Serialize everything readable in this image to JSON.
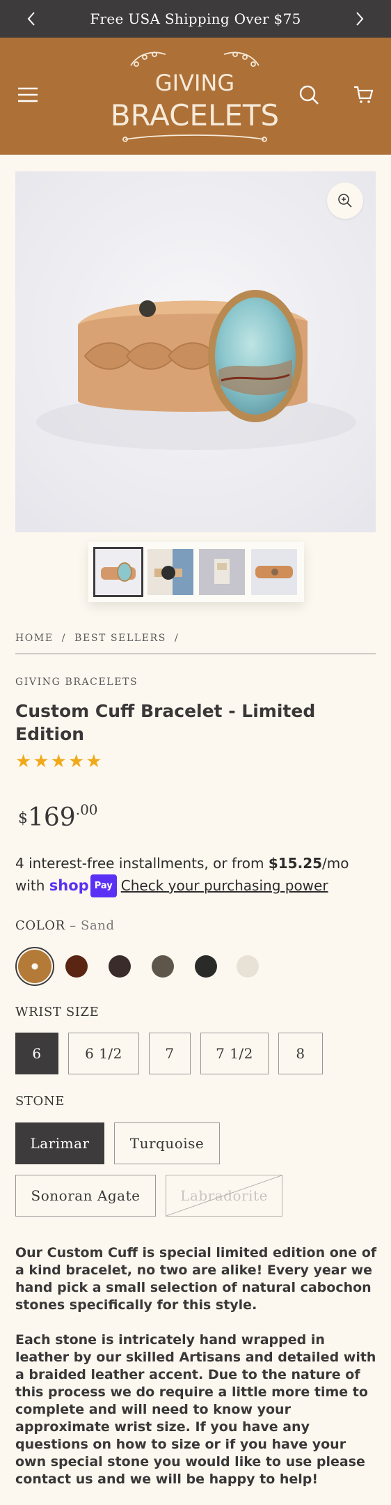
{
  "announcement": {
    "text": "Free USA Shipping Over $75"
  },
  "header": {
    "brand_line1": "GIVING",
    "brand_line2": "BRACELETS"
  },
  "breadcrumb": {
    "items": [
      "HOME",
      "/",
      "BEST SELLERS",
      "/"
    ]
  },
  "product": {
    "vendor": "GIVING BRACELETS",
    "title": "Custom Cuff Bracelet - Limited Edition",
    "rating": 5,
    "stars": [
      "★",
      "★",
      "★",
      "★",
      "★"
    ],
    "price": {
      "currency": "$",
      "whole": "169",
      "cents": ".00"
    },
    "installments": {
      "prefix": "4 interest-free installments, or from ",
      "amount": "$15.25",
      "suffix": "/mo",
      "with": "with ",
      "shop_text": "shop",
      "pay_text": "Pay",
      "link": "Check your purchasing power"
    }
  },
  "options": {
    "color": {
      "label": "COLOR",
      "selected": "– Sand",
      "swatches": [
        {
          "name": "Sand",
          "color": "#b47a38",
          "selected": true
        },
        {
          "name": "Brown",
          "color": "#5b2514"
        },
        {
          "name": "Dark Brown",
          "color": "#3b2c2c"
        },
        {
          "name": "Olive",
          "color": "#5e564a"
        },
        {
          "name": "Black",
          "color": "#2a2a28"
        },
        {
          "name": "Cream",
          "color": "#e8e1d6"
        }
      ]
    },
    "wrist_size": {
      "label": "WRIST SIZE",
      "values": [
        "6",
        "6 1/2",
        "7",
        "7 1/2",
        "8"
      ],
      "selected": "6"
    },
    "stone": {
      "label": "STONE",
      "values": [
        "Larimar",
        "Turquoise",
        "Sonoran Agate",
        "Labradorite"
      ],
      "selected": "Larimar",
      "unavailable": [
        "Labradorite"
      ]
    }
  },
  "description": {
    "p1": "Our Custom Cuff is special limited edition one of a kind bracelet, no two are alike! Every year we hand pick a small selection of natural cabochon stones specifically for this style.",
    "p2": "Each stone is intricately hand wrapped in leather by our skilled Artisans and detailed with a braided leather accent. Due to the nature of this process we do require a little more time to complete and will need to know your approximate wrist size. If you have any questions on how to size or if you have your own special stone you would like to use please contact us and we will be happy to help!"
  },
  "colors": {
    "announcement_bg": "#3e3b3d",
    "header_bg": "#ad7037",
    "page_bg": "#fcf8ef",
    "star": "#f0a91a",
    "shop_pay": "#5a31f4",
    "active_chip": "#3e3b3d"
  }
}
